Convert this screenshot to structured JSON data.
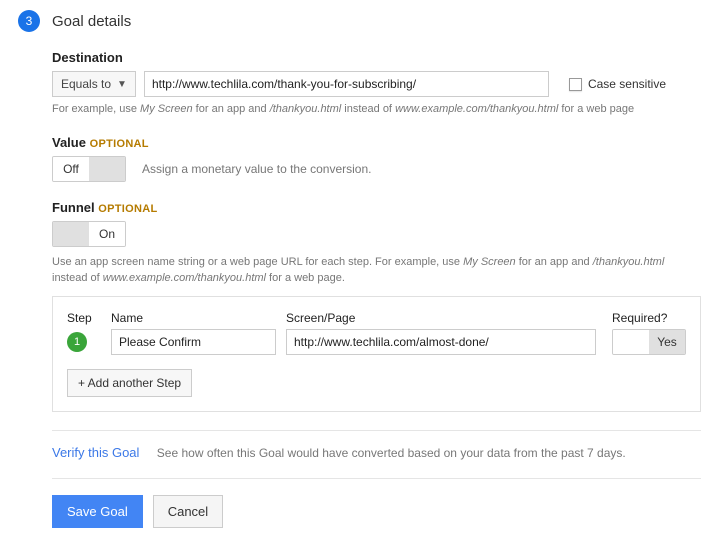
{
  "step": {
    "number": "3",
    "title": "Goal details"
  },
  "destination": {
    "label": "Destination",
    "match_type": "Equals to",
    "url": "http://www.techlila.com/thank-you-for-subscribing/",
    "case_sensitive_label": "Case sensitive",
    "help_prefix": "For example, use ",
    "help_em1": "My Screen",
    "help_mid1": " for an app and ",
    "help_em2": "/thankyou.html",
    "help_mid2": " instead of ",
    "help_em3": "www.example.com/thankyou.html",
    "help_suffix": " for a web page"
  },
  "value": {
    "label": "Value",
    "optional": "OPTIONAL",
    "toggle_off": "Off",
    "help": "Assign a monetary value to the conversion."
  },
  "funnel": {
    "label": "Funnel",
    "optional": "OPTIONAL",
    "toggle_on": "On",
    "help_prefix": "Use an app screen name string or a web page URL for each step. For example, use ",
    "help_em1": "My Screen",
    "help_mid1": " for an app and ",
    "help_em2": "/thankyou.html",
    "help_mid2": " instead of ",
    "help_em3": "www.example.com/thankyou.html",
    "help_suffix": " for a web page.",
    "headers": {
      "step": "Step",
      "name": "Name",
      "screen": "Screen/Page",
      "required": "Required?"
    },
    "steps": [
      {
        "num": "1",
        "name": "Please Confirm",
        "screen": "http://www.techlila.com/almost-done/",
        "required_yes": "Yes"
      }
    ],
    "add_step": "+ Add another Step"
  },
  "verify": {
    "link": "Verify this Goal",
    "text": "See how often this Goal would have converted based on your data from the past 7 days."
  },
  "buttons": {
    "save": "Save Goal",
    "cancel": "Cancel"
  }
}
